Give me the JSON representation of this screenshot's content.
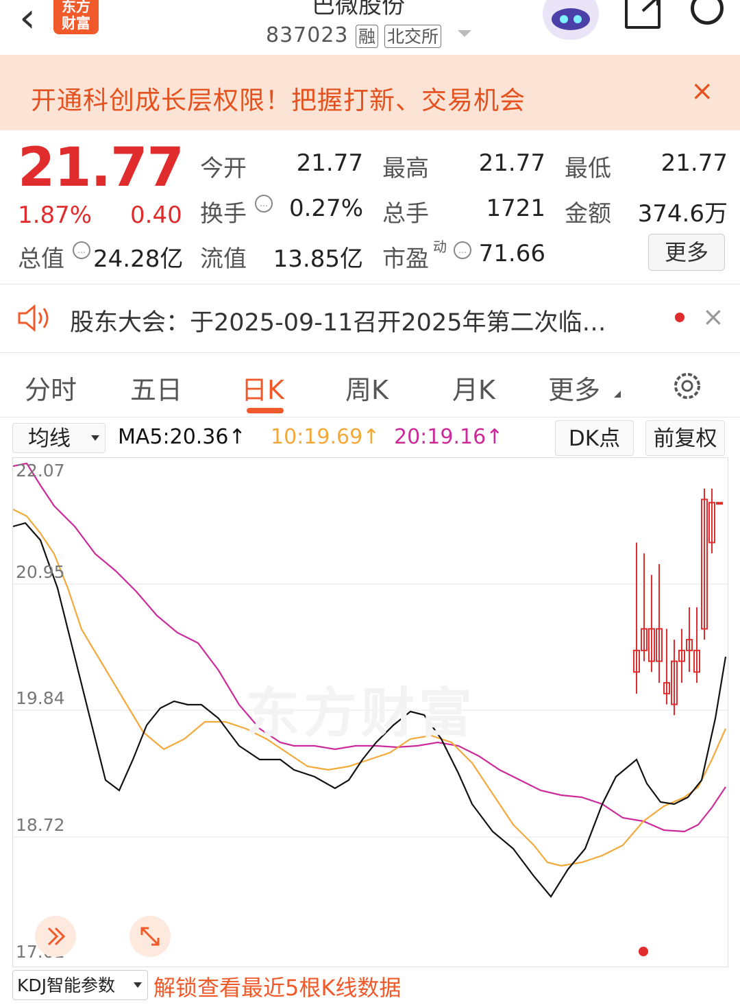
{
  "header": {
    "back_icon": "chevron-left-icon",
    "logo_line1": "东方",
    "logo_line2": "财富",
    "stock_name": "巴微股份",
    "stock_code": "837023",
    "tag_margin": "融",
    "tag_exchange": "北交所"
  },
  "banner": {
    "text": "开通科创成长层权限！把握打新、交易机会",
    "close": "×"
  },
  "quote": {
    "price": "21.77",
    "change_pct": "1.87%",
    "change_amt": "0.40",
    "total_value_label": "总值",
    "total_value": "24.28亿",
    "open_label": "今开",
    "open": "21.77",
    "high_label": "最高",
    "high": "21.77",
    "low_label": "最低",
    "low": "21.77",
    "turnover_label": "换手",
    "turnover": "0.27%",
    "volume_label": "总手",
    "volume": "1721",
    "amount_label": "金额",
    "amount": "374.6万",
    "float_value_label": "流值",
    "float_value": "13.85亿",
    "pe_label": "市盈",
    "pe_sup": "动",
    "pe": "71.66",
    "more_label": "更多"
  },
  "notice": {
    "text": "股东大会：于2025-09-11召开2025年第二次临…",
    "close": "×"
  },
  "tabs": [
    "分时",
    "五日",
    "日K",
    "周K",
    "月K",
    "更多"
  ],
  "active_tab": "日K",
  "indicators": {
    "ma_selector": "均线",
    "ma5": "MA5:20.36↑",
    "ma10": "10:19.69↑",
    "ma20": "20:19.16↑",
    "dk_label": "DK点",
    "adjust_label": "前复权",
    "colors": {
      "ma5": "#111111",
      "ma10": "#f3a93a",
      "ma20": "#cc2a9a",
      "up": "#e02c2c",
      "down": "#1a9a2a"
    }
  },
  "chart_data": {
    "type": "candlestick",
    "y_ticks": [
      "22.07",
      "20.95",
      "19.84",
      "18.72",
      "17.61"
    ],
    "ylim": [
      17.61,
      22.07
    ],
    "candles": [
      {
        "o": 20.2,
        "c": 20.4,
        "h": 21.4,
        "l": 20.0
      },
      {
        "o": 20.4,
        "c": 20.6,
        "h": 21.3,
        "l": 20.3
      },
      {
        "o": 20.3,
        "c": 20.6,
        "h": 21.1,
        "l": 20.2
      },
      {
        "o": 20.3,
        "c": 20.6,
        "h": 21.2,
        "l": 20.1
      },
      {
        "o": 20.0,
        "c": 20.1,
        "h": 20.6,
        "l": 19.9
      },
      {
        "o": 19.9,
        "c": 20.3,
        "h": 20.5,
        "l": 19.8
      },
      {
        "o": 20.3,
        "c": 20.4,
        "h": 20.6,
        "l": 20.1
      },
      {
        "o": 20.4,
        "c": 20.5,
        "h": 20.8,
        "l": 20.2
      },
      {
        "o": 20.2,
        "c": 20.4,
        "h": 20.8,
        "l": 20.1
      },
      {
        "o": 20.6,
        "c": 21.8,
        "h": 21.9,
        "l": 20.5
      },
      {
        "o": 21.4,
        "c": 21.77,
        "h": 21.9,
        "l": 21.3
      },
      {
        "o": 21.77,
        "c": 21.77,
        "h": 21.77,
        "l": 21.77
      }
    ]
  },
  "chart_icons": {
    "expand_left": "double-chevron-right-icon",
    "fullscreen": "expand-arrows-icon"
  },
  "watermark": "东方财富",
  "bottom": {
    "kdj_selector": "KDJ智能参数",
    "unlock_text": "解锁查看最近5根K线数据"
  }
}
